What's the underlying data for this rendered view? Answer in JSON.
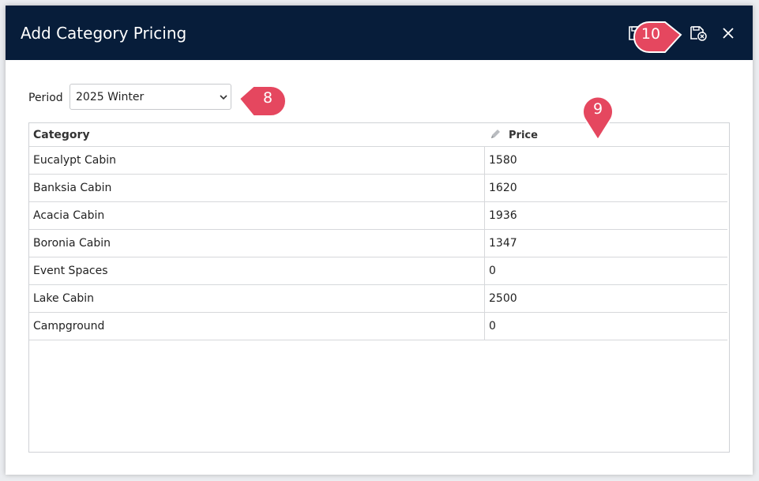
{
  "dialog": {
    "title": "Add Category Pricing",
    "header_icons": [
      "save-icon",
      "save-close-icon",
      "close-icon"
    ]
  },
  "period": {
    "label": "Period",
    "selected": "2025 Winter"
  },
  "table": {
    "headers": {
      "category": "Category",
      "price": "Price"
    },
    "rows": [
      {
        "category": "Eucalypt Cabin",
        "price": "1580"
      },
      {
        "category": "Banksia Cabin",
        "price": "1620"
      },
      {
        "category": "Acacia Cabin",
        "price": "1936"
      },
      {
        "category": "Boronia Cabin",
        "price": "1347"
      },
      {
        "category": "Event Spaces",
        "price": "0"
      },
      {
        "category": "Lake Cabin",
        "price": "2500"
      },
      {
        "category": "Campground",
        "price": "0"
      }
    ]
  },
  "callouts": [
    "8",
    "9",
    "10"
  ],
  "colors": {
    "header_bg": "#071d3a",
    "callout": "#e5475f",
    "border": "#d6d8db"
  }
}
